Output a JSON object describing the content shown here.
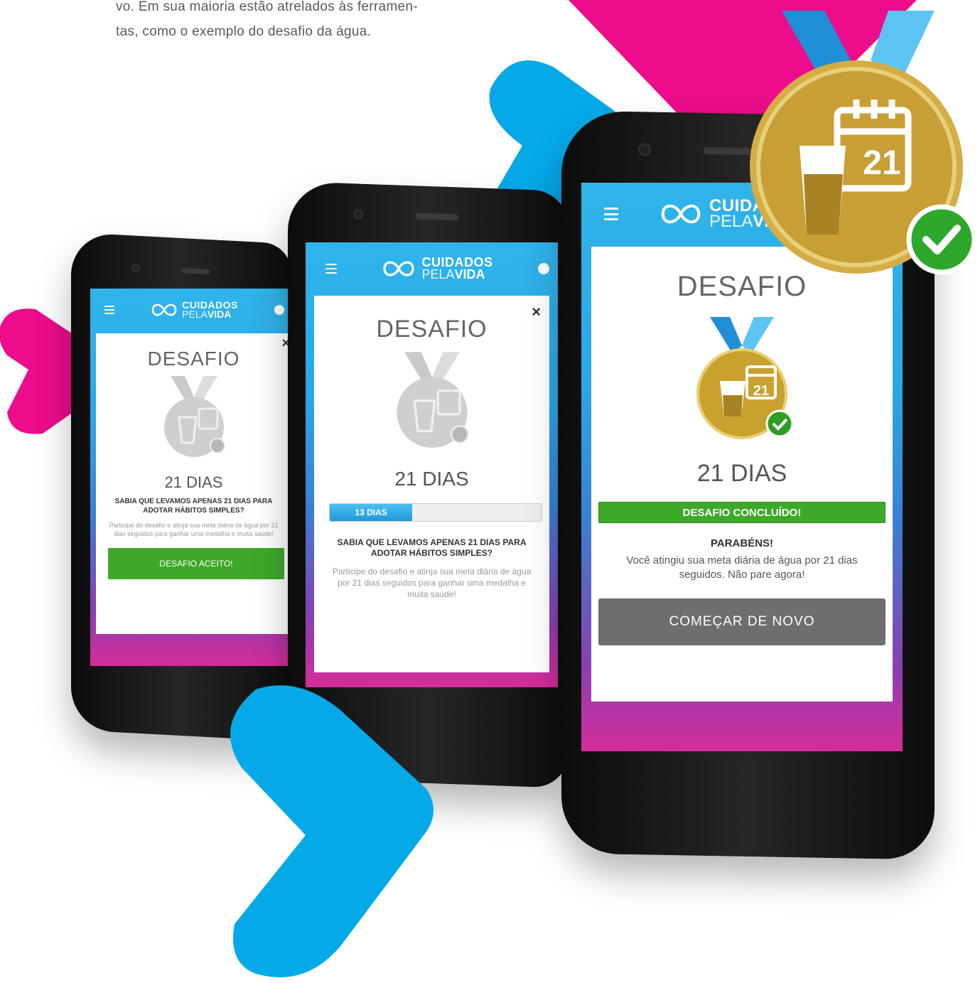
{
  "intro": {
    "line1": "vo. Em sua maioria estão atrelados às ferramen-",
    "line2": "tas, como o exemplo do desafio da água."
  },
  "colors": {
    "pink": "#ec0c8c",
    "blue": "#05a9e8",
    "green": "#3ea82a",
    "gold": "#c9a12f"
  },
  "brand": {
    "line1": "CUIDADOS",
    "line2_pela": "PELA",
    "line2_vida": "VIDA"
  },
  "phones": [
    {
      "title": "DESAFIO",
      "days": "21 DIAS",
      "question": "SABIA QUE LEVAMOS APENAS 21 DIAS PARA ADOTAR HÁBITOS SIMPLES?",
      "description": "Participe do desafio e atinja sua meta diária de água por 21 dias seguidos para ganhar uma medalha e muita saúde!",
      "button": "DESAFIO ACEITO!",
      "close": "×"
    },
    {
      "title": "DESAFIO",
      "days": "21 DIAS",
      "progress_label": "13 DIAS",
      "progress_fraction": 0.39,
      "question": "SABIA QUE LEVAMOS APENAS 21 DIAS PARA ADOTAR HÁBITOS SIMPLES?",
      "description": "Participe do desafio e atinja sua meta diária de água por 21 dias seguidos para ganhar uma medalha e muita saúde!",
      "close": "×"
    },
    {
      "title": "DESAFIO",
      "days": "21 DIAS",
      "status": "DESAFIO CONCLUÍDO!",
      "congrats": "PARABÉNS!",
      "message": "Você atingiu sua meta diária de água por 21 dias seguidos. Não pare agora!",
      "button": "COMEÇAR DE NOVO"
    }
  ],
  "medal": {
    "number": "21"
  }
}
